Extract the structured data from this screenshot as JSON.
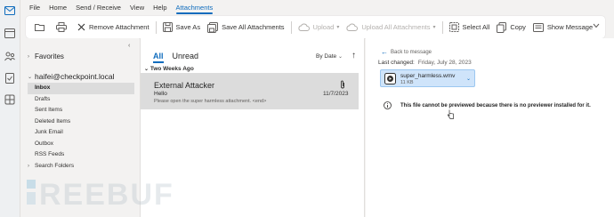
{
  "rail": {
    "icons": [
      "mail-icon",
      "calendar-icon",
      "people-icon",
      "tasks-icon",
      "apps-icon"
    ]
  },
  "menu": {
    "tabs": [
      "File",
      "Home",
      "Send / Receive",
      "View",
      "Help",
      "Attachments"
    ],
    "active_tab": "Attachments"
  },
  "ribbon": {
    "open_label": "",
    "print_label": "",
    "remove_label": "Remove Attachment",
    "save_as_label": "Save As",
    "save_all_label": "Save All Attachments",
    "upload_label": "Upload",
    "upload_all_label": "Upload All Attachments",
    "select_all_label": "Select All",
    "copy_label": "Copy",
    "show_message_label": "Show Message"
  },
  "folders": {
    "favorites_label": "Favorites",
    "account": "haifei@checkpoint.local",
    "items": [
      {
        "label": "Inbox",
        "selected": true
      },
      {
        "label": "Drafts"
      },
      {
        "label": "Sent Items"
      },
      {
        "label": "Deleted Items"
      },
      {
        "label": "Junk Email"
      },
      {
        "label": "Outbox"
      },
      {
        "label": "RSS Feeds"
      },
      {
        "label": "Search Folders"
      }
    ]
  },
  "message_list": {
    "filter_all": "All",
    "filter_unread": "Unread",
    "sort_label": "By Date",
    "group_header": "Two Weeks Ago",
    "messages": [
      {
        "sender": "External Attacker",
        "subject": "Hello",
        "preview": "Please open the super harmless attachment. <end>",
        "date": "11/7/2023",
        "has_attachment": true
      }
    ]
  },
  "reading_pane": {
    "back_label": "Back to message",
    "last_changed_label": "Last changed:",
    "last_changed_value": "Friday, July 28, 2023",
    "attachment_name": "super_harmless.wmv",
    "attachment_size": "11 KB",
    "notice": "This file cannot be previewed because there is no previewer installed for it."
  },
  "colors": {
    "accent": "#0f6cbd",
    "selected_row": "#dcdcdc",
    "attachment_bg": "#cfe4fa"
  },
  "watermark_text": "FREEBUF"
}
